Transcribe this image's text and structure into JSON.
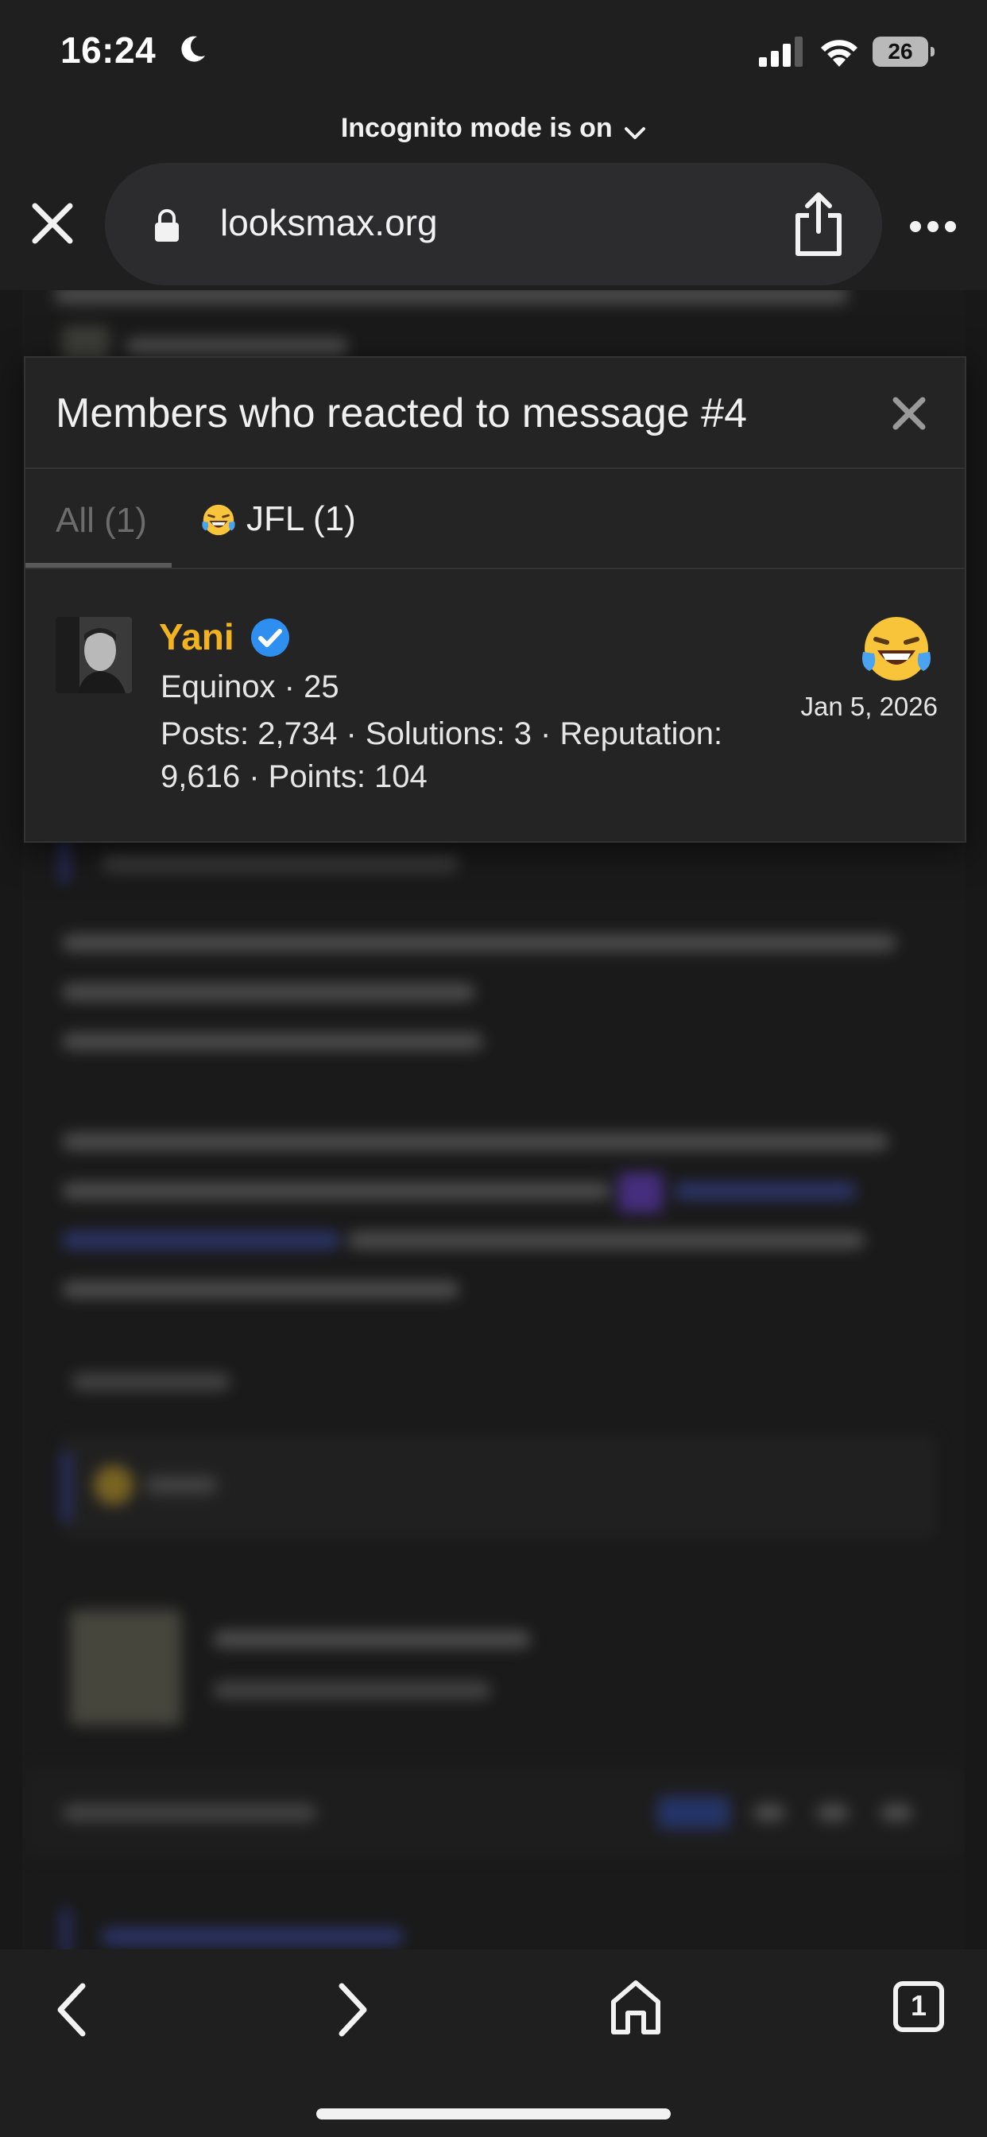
{
  "status_bar": {
    "time": "16:24",
    "battery": "26"
  },
  "browser": {
    "incognito_label": "Incognito mode is on",
    "url": "looksmax.org",
    "open_tabs": "1"
  },
  "modal": {
    "title": "Members who reacted to message #4",
    "tabs": [
      {
        "label": "All (1)"
      },
      {
        "label": "JFL (1)"
      }
    ],
    "members": [
      {
        "username": "Yani",
        "title": "Equinox · 25",
        "stats": "Posts: 2,734 · Solutions: 3 · Reputation: 9,616 · Points: 104",
        "date": "Jan 5, 2026"
      }
    ]
  },
  "colors": {
    "username": "#f2b31f",
    "verified_badge": "#2f8ff0",
    "background": "#181818"
  }
}
